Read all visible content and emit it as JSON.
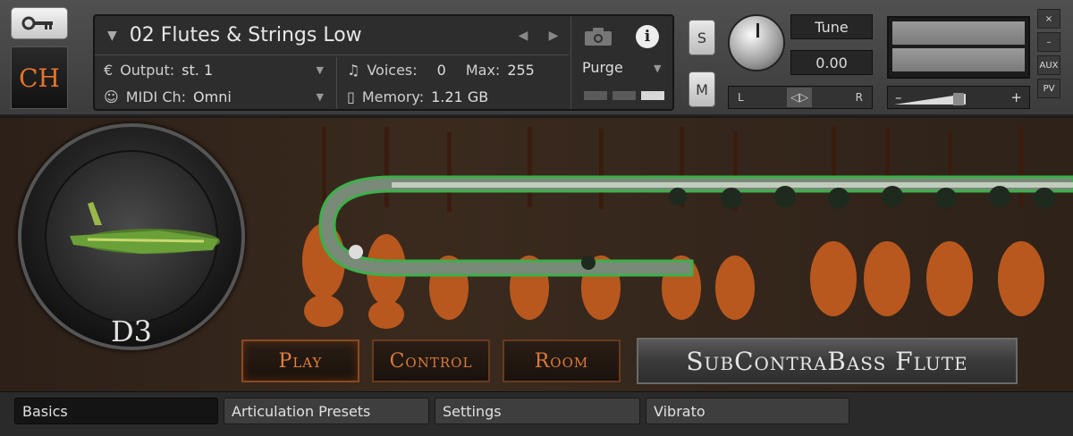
{
  "header": {
    "logo_text": "CH",
    "instrument_title": "02 Flutes & Strings Low",
    "output_label": "Output:",
    "output_value": "st. 1",
    "voices_label": "Voices:",
    "voices_value": "0",
    "max_label": "Max:",
    "max_value": "255",
    "midi_label": "MIDI Ch:",
    "midi_value": "Omni",
    "memory_label": "Memory:",
    "memory_value": "1.21 GB",
    "purge_label": "Purge",
    "solo_label": "S",
    "mute_label": "M",
    "tune_label": "Tune",
    "tune_value": "0.00",
    "pan_left": "L",
    "pan_right": "R",
    "vol_minus": "–",
    "vol_plus": "+",
    "side_close": "×",
    "side_min": "–",
    "side_aux": "AUX",
    "side_pv": "PV"
  },
  "main": {
    "note_name": "D3",
    "tabs": [
      {
        "label": "Play",
        "selected": true
      },
      {
        "label": "Control",
        "selected": false
      },
      {
        "label": "Room",
        "selected": false
      }
    ],
    "instrument_name": "SubContraBass Flute"
  },
  "bottom_tabs": [
    {
      "label": "Basics",
      "active": true
    },
    {
      "label": "Articulation Presets",
      "active": false
    },
    {
      "label": "Settings",
      "active": false
    },
    {
      "label": "Vibrato",
      "active": false
    }
  ],
  "colors": {
    "accent_orange": "#e8742a",
    "flute_green": "#3cb04a"
  }
}
